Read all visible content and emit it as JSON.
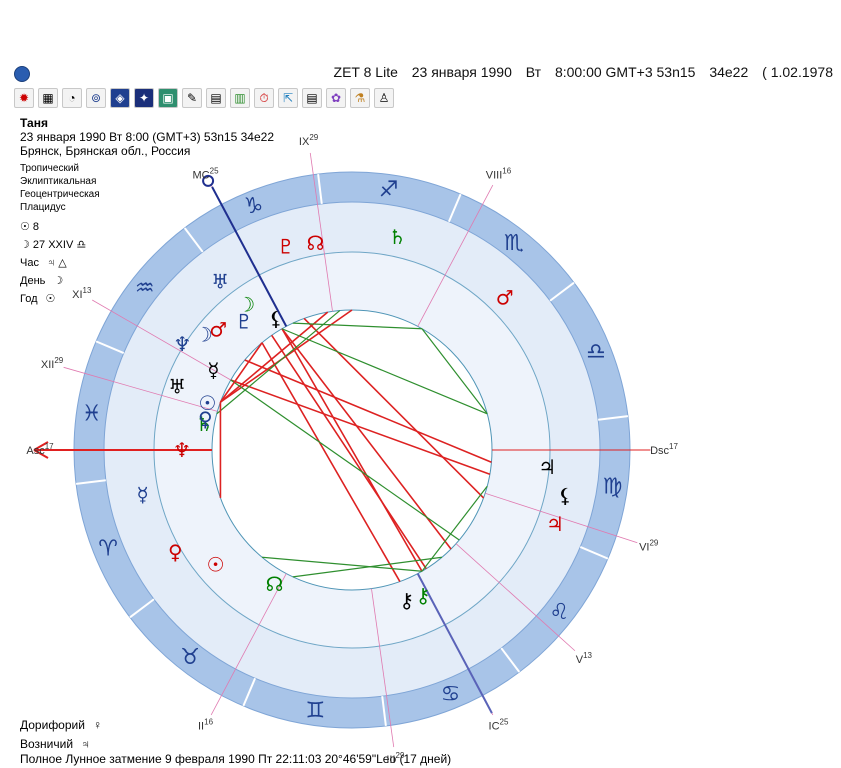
{
  "window": {
    "title_parts": [
      "ZET 8 Lite",
      "23 января 1990",
      "Вт",
      "8:00:00 GMT+3 53n15",
      "34e22",
      "( 1.02.1978"
    ]
  },
  "toolbar": {
    "icons": [
      "gear-icon",
      "grid-icon",
      "globe-icon",
      "chart-icon",
      "cosmos-icon",
      "star-icon",
      "map-icon",
      "book-icon",
      "list-icon",
      "calendar-icon",
      "clock-icon",
      "export-icon",
      "notes-icon",
      "settings-icon",
      "person-icon",
      "user-icon"
    ],
    "glyphs": [
      "✹",
      "▦",
      "◔",
      "⊚",
      "◈",
      "✦",
      "▣",
      "✎",
      "▤",
      "▥",
      "⏱",
      "⇱",
      "▤",
      "✿",
      "⚗",
      "♙"
    ]
  },
  "chart_info": {
    "name": "Таня",
    "datetime": "23 января 1990  Вт   8:00 (GMT+3) 53n15  34e22",
    "place": "Брянск, Брянская обл., Россия"
  },
  "settings": [
    "Тропический",
    "Эклиптикальная",
    "Геоцентрическая",
    "Плацидус"
  ],
  "extra": {
    "sun_label": "☉  8",
    "moon_label": "☽  27 XXIV ♎",
    "hour_label": "Час",
    "hour_value": "♃ △",
    "day_label": "День",
    "day_value": "☽",
    "year_label": "Год",
    "year_value": "☉"
  },
  "bottom": {
    "doryphory_label": "Дорифорий",
    "doryphory_value": "♀",
    "charioteer_label": "Возничий",
    "charioteer_value": "♃",
    "eclipse": "Полное Лунное затмение 9 февраля 1990 Пт 22:11:03 20°46'59\"Leo (17 дней)"
  },
  "houses": [
    {
      "label": "Asc",
      "sup": "17"
    },
    {
      "label": "MC",
      "sup": "25"
    },
    {
      "label": "IX",
      "sup": "29"
    },
    {
      "label": "VIII",
      "sup": "16"
    },
    {
      "label": "XI",
      "sup": "13"
    },
    {
      "label": "XII",
      "sup": "29"
    },
    {
      "label": "Dsc",
      "sup": "17"
    },
    {
      "label": "VI",
      "sup": "29"
    },
    {
      "label": "V",
      "sup": "13"
    },
    {
      "label": "IC",
      "sup": "25"
    },
    {
      "label": "III",
      "sup": "29"
    },
    {
      "label": "II",
      "sup": "16"
    }
  ],
  "signs": [
    "♑",
    "♐",
    "♏",
    "♎",
    "♍",
    "♌",
    "♋",
    "♊",
    "♉",
    "♈",
    "♓",
    "♒"
  ],
  "planets": [
    {
      "glyph": "♅",
      "color": "#000000"
    },
    {
      "glyph": "☿",
      "color": "#000000"
    },
    {
      "glyph": "♆",
      "color": "#cc0000"
    },
    {
      "glyph": "♄",
      "color": "#008000"
    },
    {
      "glyph": "♀",
      "color": "#1f3f8f"
    },
    {
      "glyph": "☉",
      "color": "#1f3f8f"
    },
    {
      "glyph": "♂",
      "color": "#cc0000"
    },
    {
      "glyph": "☽",
      "color": "#1f3f8f"
    },
    {
      "glyph": "♆",
      "color": "#1f3f8f"
    },
    {
      "glyph": "♇",
      "color": "#1f3f8f"
    },
    {
      "glyph": "⚸",
      "color": "#000000"
    },
    {
      "glyph": "☽",
      "color": "#008000"
    },
    {
      "glyph": "♅",
      "color": "#1f3f8f"
    },
    {
      "glyph": "♇",
      "color": "#cc0000"
    },
    {
      "glyph": "☊",
      "color": "#cc0000"
    },
    {
      "glyph": "♄",
      "color": "#008000"
    },
    {
      "glyph": "♂",
      "color": "#cc0000"
    },
    {
      "glyph": "♃",
      "color": "#000000"
    },
    {
      "glyph": "⚸",
      "color": "#000000"
    },
    {
      "glyph": "♃",
      "color": "#cc0000"
    },
    {
      "glyph": "⚷",
      "color": "#008000"
    },
    {
      "glyph": "⚷",
      "color": "#000000"
    },
    {
      "glyph": "☊",
      "color": "#008000"
    },
    {
      "glyph": "☉",
      "color": "#cc0000"
    },
    {
      "glyph": "♀",
      "color": "#cc0000"
    },
    {
      "glyph": "☿",
      "color": "#1f3f8f"
    }
  ],
  "colors": {
    "ring_outer": "#a8c4e8",
    "ring_inner": "#e3ecf8",
    "aspect_red": "#dd2222",
    "aspect_green": "#2f8f2f",
    "axis_blue": "#1f2f8f",
    "house_line": "#e07ab0"
  }
}
